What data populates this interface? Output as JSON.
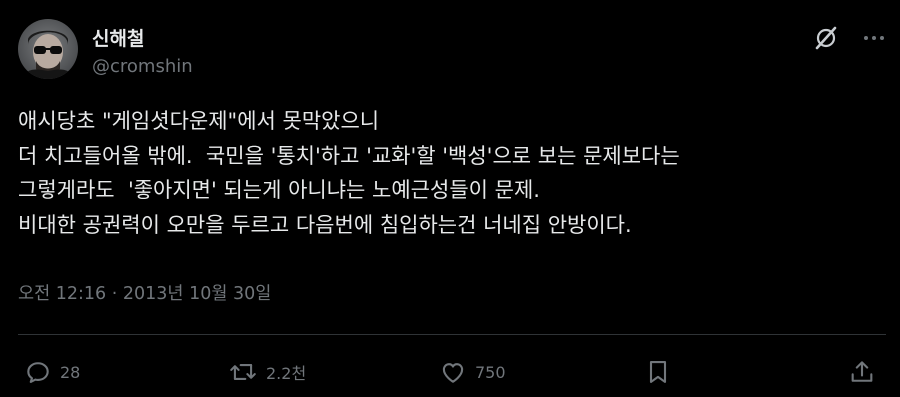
{
  "author": {
    "display_name": "신해철",
    "handle": "@cromshin",
    "avatar_icon": "avatar-photo"
  },
  "header": {
    "grok_icon": "grok-slash-icon",
    "more_icon": "more-dots-icon"
  },
  "tweet": {
    "lines": [
      "애시당초 \"게임셧다운제\"에서 못막았으니",
      "더 치고들어올 밖에.  국민을 '통치'하고 '교화'할 '백성'으로 보는 문제보다는",
      "그렇게라도  '좋아지면' 되는게 아니냐는 노예근성들이 문제.",
      "비대한 공권력이 오만을 두르고 다음번에 침입하는건 너네집 안방이다."
    ],
    "timestamp": "오전 12:16 · 2013년 10월 30일"
  },
  "actions": {
    "reply": {
      "icon": "reply-bubble-icon",
      "count": "28"
    },
    "retweet": {
      "icon": "retweet-icon",
      "count": "2.2천"
    },
    "like": {
      "icon": "heart-icon",
      "count": "750"
    },
    "bookmark": {
      "icon": "bookmark-icon"
    },
    "share": {
      "icon": "share-upload-icon"
    }
  },
  "colors": {
    "background": "#000000",
    "text_primary": "#e7e9ea",
    "text_secondary": "#71767b",
    "divider": "#2f3336"
  }
}
